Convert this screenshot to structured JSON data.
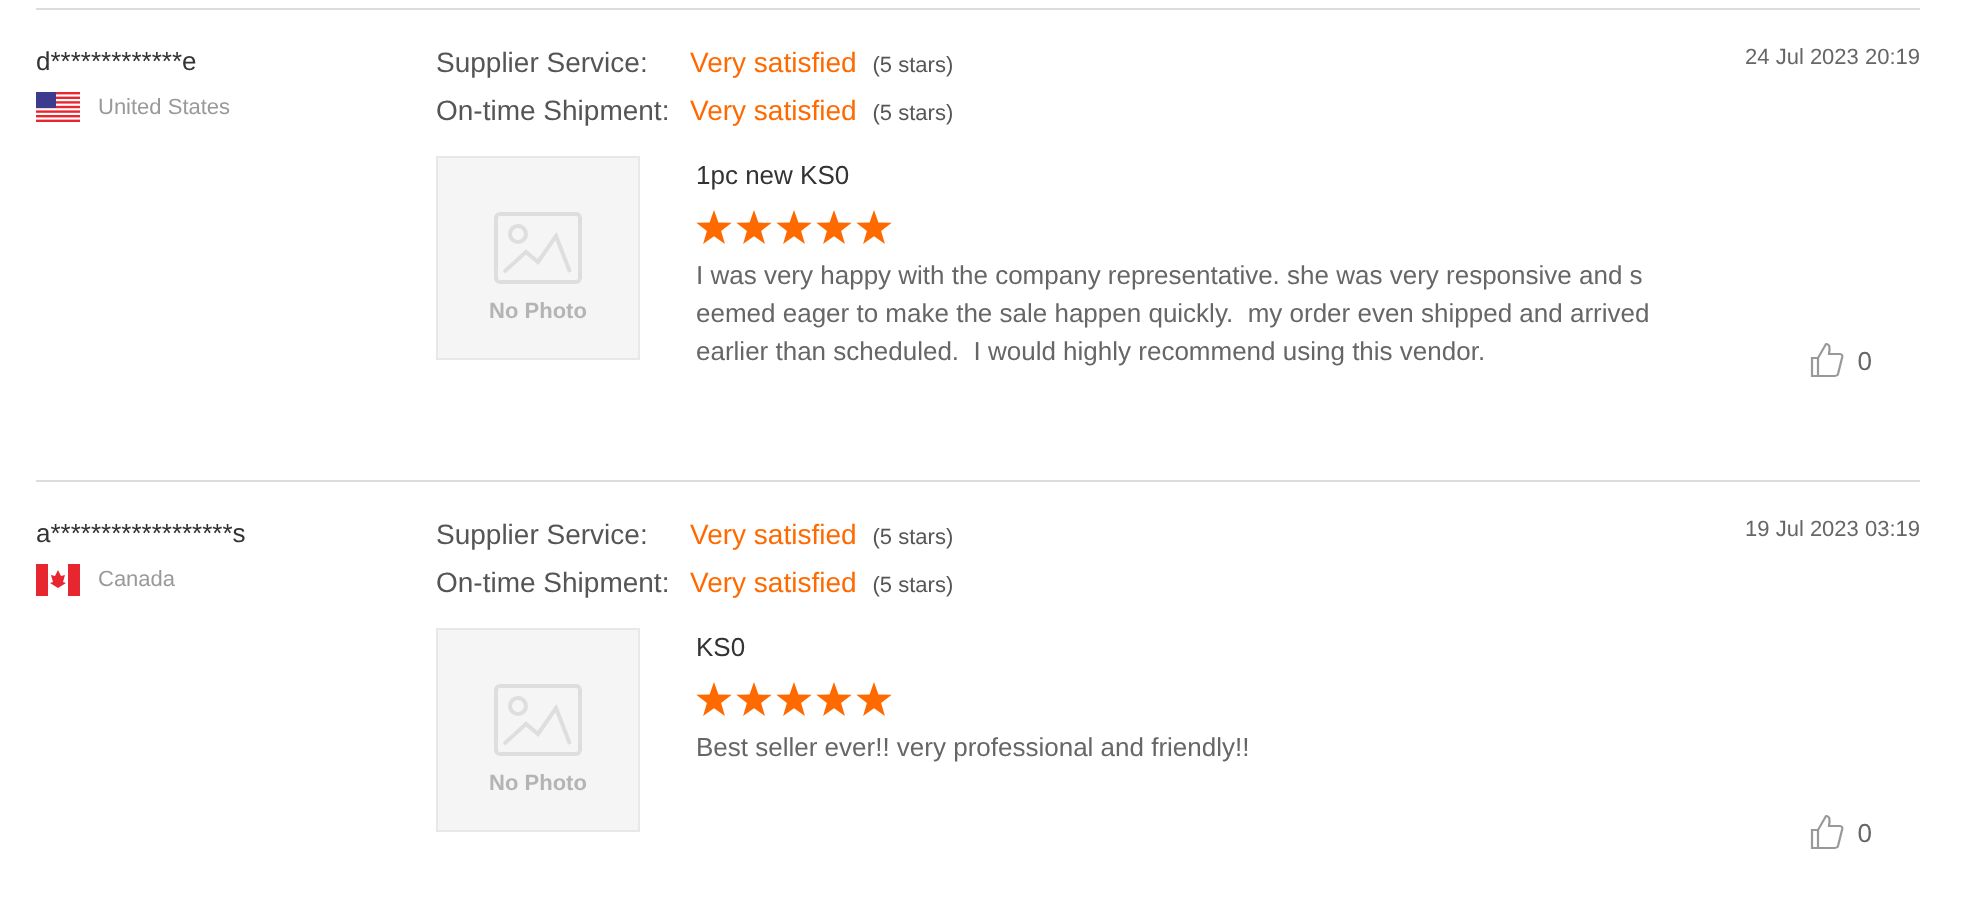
{
  "reviews": [
    {
      "buyer": "d*************e",
      "country": "United States",
      "flag": {
        "kind": "us"
      },
      "ratings": [
        {
          "label": "Supplier Service:",
          "value": "Very satisfied",
          "note": "(5 stars)"
        },
        {
          "label": "On-time Shipment:",
          "value": "Very satisfied",
          "note": "(5 stars)"
        }
      ],
      "date": "24 Jul 2023 20:19",
      "photo_label": "No Photo",
      "product": "1pc new KS0",
      "stars": 5,
      "text_lines": [
        "I was very happy with the company representative. she was very responsive and s",
        "eemed eager to make the sale happen quickly.  my order even shipped and arrived",
        "earlier than scheduled.  I would highly recommend using this vendor."
      ],
      "likes": "0"
    },
    {
      "buyer": "a******************s",
      "country": "Canada",
      "flag": {
        "kind": "ca"
      },
      "ratings": [
        {
          "label": "Supplier Service:",
          "value": "Very satisfied",
          "note": "(5 stars)"
        },
        {
          "label": "On-time Shipment:",
          "value": "Very satisfied",
          "note": "(5 stars)"
        }
      ],
      "date": "19 Jul 2023 03:19",
      "photo_label": "No Photo",
      "product": "KS0",
      "stars": 5,
      "text_lines": [
        "Best seller ever!! very professional and friendly!!"
      ],
      "likes": "0"
    }
  ]
}
